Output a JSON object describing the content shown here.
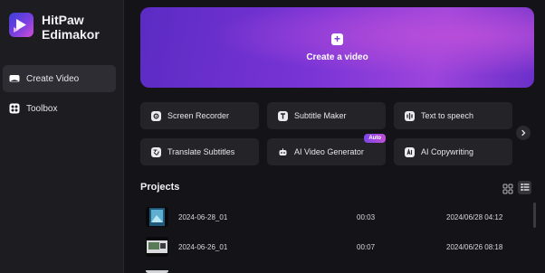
{
  "app": {
    "name_line1": "HitPaw",
    "name_line2": "Edimakor"
  },
  "sidebar": {
    "items": [
      {
        "label": "Create Video",
        "icon": "create-video-icon",
        "active": true
      },
      {
        "label": "Toolbox",
        "icon": "toolbox-icon",
        "active": false
      }
    ]
  },
  "hero": {
    "label": "Create a video",
    "icon": "plus-icon"
  },
  "tools": [
    {
      "label": "Screen Recorder",
      "icon": "screen-recorder-icon"
    },
    {
      "label": "Subtitle Maker",
      "icon": "subtitle-maker-icon"
    },
    {
      "label": "Text to speech",
      "icon": "text-to-speech-icon"
    },
    {
      "label": "Translate Subtitles",
      "icon": "translate-icon"
    },
    {
      "label": "AI Video Generator",
      "icon": "robot-icon",
      "badge": "Auto"
    },
    {
      "label": "AI Copywriting",
      "icon": "ai-copywriting-icon"
    }
  ],
  "projects": {
    "title": "Projects",
    "rows": [
      {
        "name": "2024-06-28_01",
        "duration": "00:03",
        "modified": "2024/06/28 04:12"
      },
      {
        "name": "2024-06-26_01",
        "duration": "00:07",
        "modified": "2024/06/26 08:18"
      }
    ]
  },
  "colors": {
    "accent": "#8a3fe0",
    "sidebar_bg": "#1c1c21",
    "main_bg": "#141418",
    "card_bg": "#232328"
  }
}
